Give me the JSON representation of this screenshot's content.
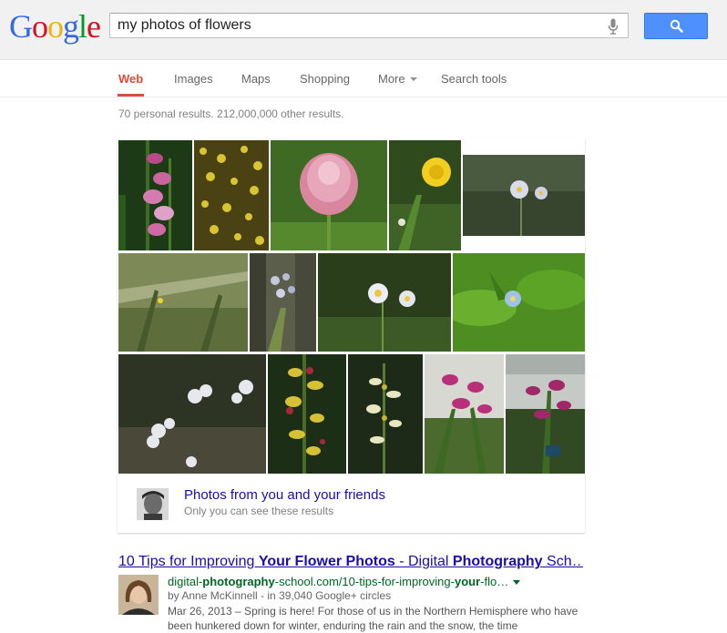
{
  "logo": {
    "letters": [
      "G",
      "o",
      "o",
      "g",
      "l",
      "e"
    ],
    "colors": [
      "#3369e8",
      "#d50f25",
      "#eeb211",
      "#3369e8",
      "#009925",
      "#d50f25"
    ]
  },
  "search": {
    "query": "my photos of flowers",
    "button_icon": "magnifier-icon",
    "mic_icon": "microphone-icon"
  },
  "tabs": [
    {
      "label": "Web",
      "active": true
    },
    {
      "label": "Images"
    },
    {
      "label": "Maps"
    },
    {
      "label": "Shopping"
    },
    {
      "label": "More"
    },
    {
      "label": "Search tools"
    }
  ],
  "stats": "70 personal results. 212,000,000 other results.",
  "photos_panel": {
    "link": "Photos from you and your friends",
    "note": "Only you can see these results"
  },
  "result": {
    "title_parts": [
      "10 Tips for Improving ",
      "Your Flower Photos",
      " - Digital ",
      "Photography",
      " Sch…"
    ],
    "url_parts": [
      "digital-",
      "photography",
      "-school.com/10-tips-for-improving-",
      "your",
      "-flo…"
    ],
    "byline": "by Anne McKinnell - in 39,040 Google+ circles",
    "snippet_date": "Mar 26, 2013",
    "snippet_text": " – Spring is here! For those of us in the Northern Hemisphere who have been hunkered down for winter, enduring the rain and the snow, the time"
  },
  "colors": {
    "accent": "#dd4b39",
    "link": "#1a0dab",
    "url": "#006621",
    "button": "#4d90fe"
  }
}
